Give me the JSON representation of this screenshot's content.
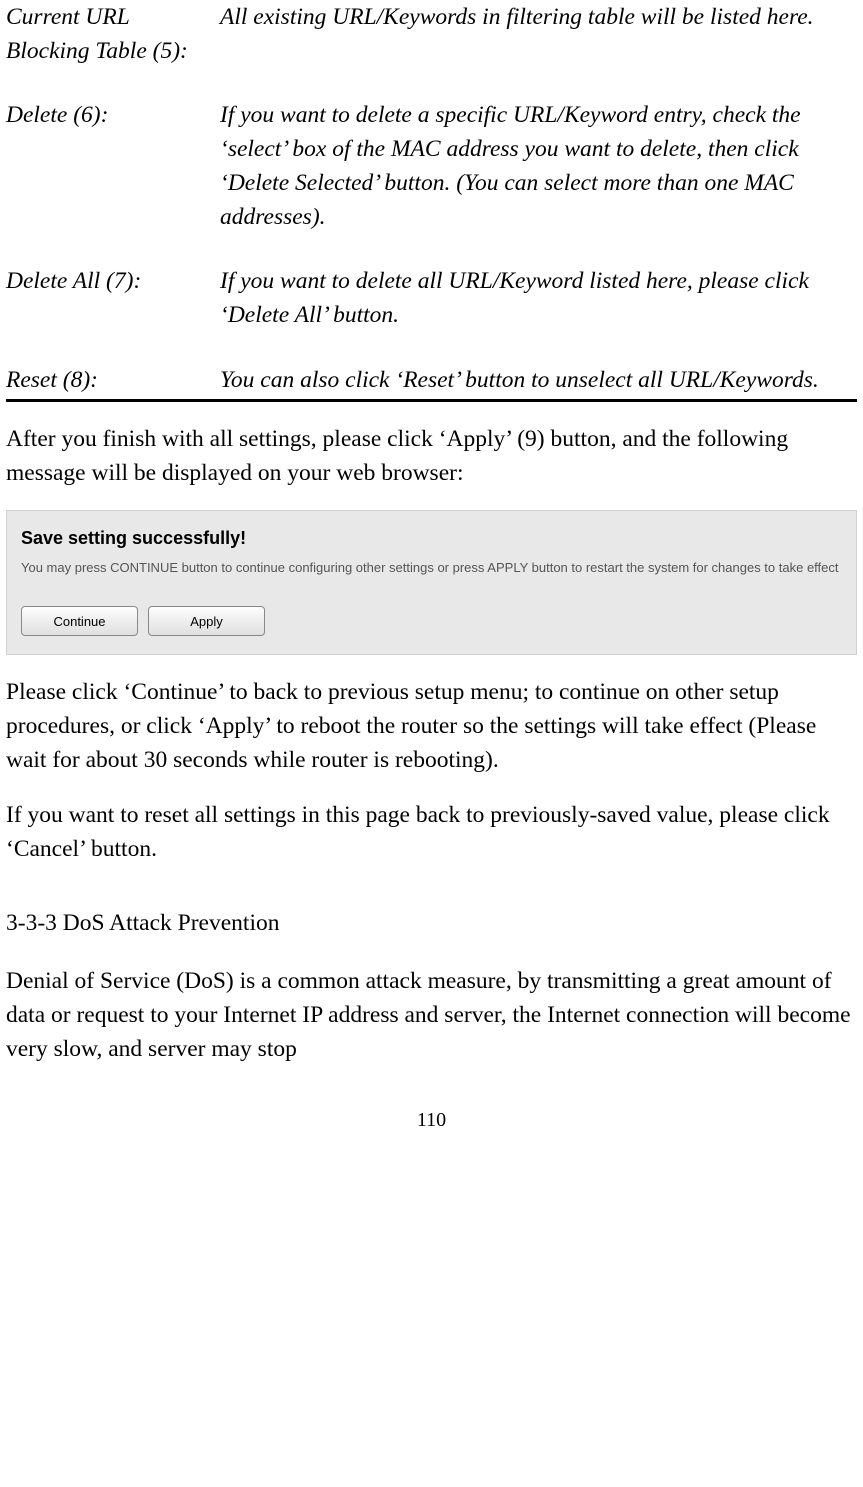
{
  "defs": [
    {
      "term": "Current URL Blocking Table (5):",
      "desc": "All existing URL/Keywords in filtering table will be listed here."
    },
    {
      "term": "Delete (6):",
      "desc": "If you want to delete a specific URL/Keyword entry, check the ‘select’ box of the MAC address you want to delete, then click ‘Delete Selected’ button. (You can select more than one MAC addresses)."
    },
    {
      "term": "Delete All (7):",
      "desc": "If you want to delete all URL/Keyword listed here, please click ‘Delete All’ button."
    },
    {
      "term": "Reset (8):",
      "desc": "You can also click ‘Reset’ button to unselect all URL/Keywords."
    }
  ],
  "para_apply": "After you finish with all settings, please click ‘Apply’ (9) button, and the following message will be displayed on your web browser:",
  "dialog": {
    "title": "Save setting successfully!",
    "text": "You may press CONTINUE button to continue configuring other settings or press APPLY button to restart the system for changes to take effect",
    "continue_label": "Continue",
    "apply_label": "Apply"
  },
  "para_continue": "Please click ‘Continue’ to back to previous setup menu; to continue on other setup procedures, or click ‘Apply’ to reboot the router so the settings will take effect (Please wait for about 30 seconds while router is rebooting).",
  "para_cancel": "If you want to reset all settings in this page back to previously-saved value, please click ‘Cancel’ button.",
  "section_heading": "3-3-3 DoS Attack Prevention",
  "para_dos": "Denial of Service (DoS) is a common attack measure, by transmitting a great amount of data or request to your Internet IP address and server, the Internet connection will become very slow, and server may stop",
  "page_number": "110"
}
